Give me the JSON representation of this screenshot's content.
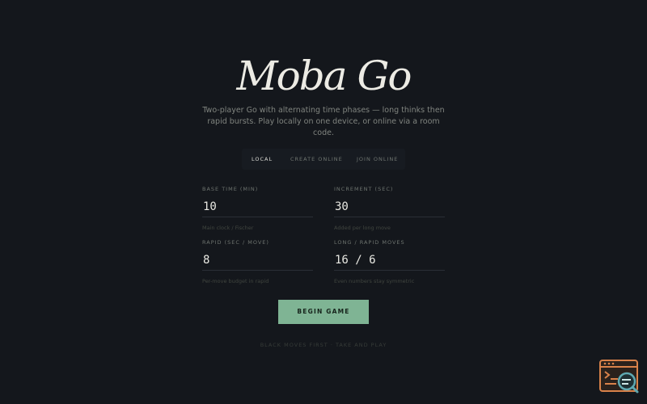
{
  "app": {
    "title": "Moba Go",
    "subtitle": "Two-player Go with alternating time phases — long thinks then rapid bursts. Play locally on one device, or online via a room code."
  },
  "tabs": [
    {
      "label": "LOCAL",
      "active": true
    },
    {
      "label": "CREATE ONLINE",
      "active": false
    },
    {
      "label": "JOIN ONLINE",
      "active": false
    }
  ],
  "fields": {
    "base_time": {
      "label": "BASE TIME (MIN)",
      "value": "10",
      "hint": "Main clock / Fischer"
    },
    "increment": {
      "label": "INCREMENT (SEC)",
      "value": "30",
      "hint": "Added per long move"
    },
    "rapid": {
      "label": "RAPID (SEC / MOVE)",
      "value": "8",
      "hint": "Per-move budget in rapid"
    },
    "long_rapid": {
      "label": "LONG / RAPID MOVES",
      "value": "16 / 6",
      "hint": "Even numbers stay symmetric"
    }
  },
  "actions": {
    "begin_label": "BEGIN GAME"
  },
  "footer": {
    "text": "BLACK MOVES FIRST · TAKE AND PLAY"
  },
  "colors": {
    "background": "#14171c",
    "accent": "#7fb494",
    "corner_icon": "#d9824a"
  },
  "icons": {
    "corner": "terminal-search-icon"
  }
}
